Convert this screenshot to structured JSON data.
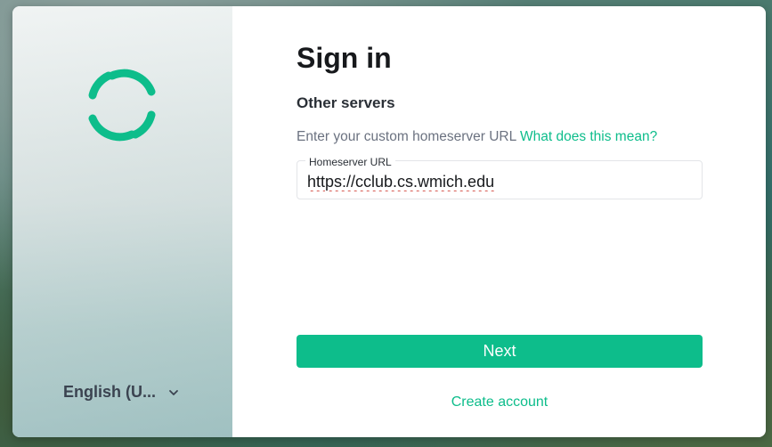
{
  "dialog": {
    "title": "Sign in",
    "subtitle": "Other servers",
    "description": "Enter your custom homeserver URL",
    "help_link": "What does this mean?",
    "field": {
      "label": "Homeserver URL",
      "value": "https://cclub.cs.wmich.edu"
    },
    "next_label": "Next",
    "create_account_label": "Create account"
  },
  "sidebar": {
    "language_label": "English (U...",
    "logo_icon": "element-logo-icon",
    "chevron_icon": "chevron-down-icon"
  },
  "colors": {
    "accent": "#0dbd8b",
    "title_text": "#17191c",
    "secondary_text": "#6b7280"
  }
}
